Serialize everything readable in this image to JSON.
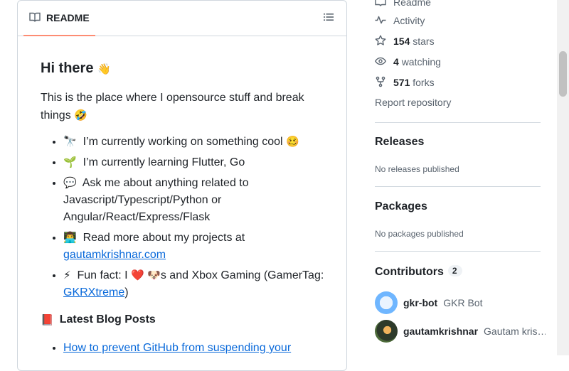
{
  "readme": {
    "tab_label": "README",
    "heading": "Hi there",
    "heading_emoji": "👋",
    "intro": "This is the place where I opensource stuff and break things",
    "intro_emoji": "🤣",
    "bullets": [
      {
        "emoji": "🔭",
        "text": "I’m currently working on something cool",
        "end_emoji": "🥴"
      },
      {
        "emoji": "🌱",
        "text": "I’m currently learning Flutter, Go"
      },
      {
        "emoji": "💬",
        "text": "Ask me about anything related to Javascript/Typescript/Python or Angular/React/Express/Flask"
      },
      {
        "emoji": "👨‍💻",
        "text": "Read more about my projects at",
        "link": "gautamkrishnar.com"
      },
      {
        "emoji": "⚡",
        "text_a": "Fun fact: I",
        "heart": "❤️",
        "dog": "🐶",
        "text_b": "s and Xbox Gaming (GamerTag:",
        "link": "GKRXtreme",
        "text_c": ")"
      }
    ],
    "blog_heading": "Latest Blog Posts",
    "blog_emoji": "📕",
    "blog_posts": [
      "How to prevent GitHub from suspending your"
    ]
  },
  "about": {
    "readme_link": "Readme",
    "activity": "Activity",
    "stars_count": "154",
    "stars_label": "stars",
    "watching_count": "4",
    "watching_label": "watching",
    "forks_count": "571",
    "forks_label": "forks",
    "report": "Report repository"
  },
  "releases": {
    "title": "Releases",
    "empty": "No releases published"
  },
  "packages": {
    "title": "Packages",
    "empty": "No packages published"
  },
  "contributors": {
    "title": "Contributors",
    "count": "2",
    "items": [
      {
        "login": "gkr-bot",
        "name": "GKR Bot"
      },
      {
        "login": "gautamkrishnar",
        "name": "Gautam kris…"
      }
    ]
  },
  "colors": {
    "link": "#0969da",
    "tab_underline": "#fd8c73",
    "border": "#d0d7de",
    "muted": "#59636e"
  },
  "icons": [
    "book-icon",
    "list-icon",
    "pulse-icon",
    "star-icon",
    "eye-icon",
    "fork-icon"
  ]
}
